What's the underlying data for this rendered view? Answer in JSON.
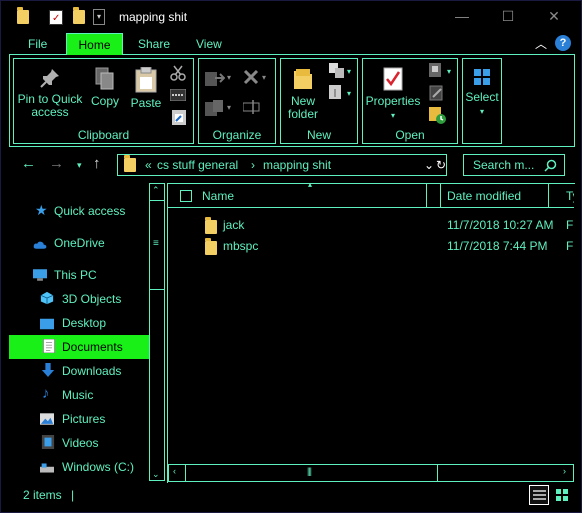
{
  "window": {
    "title": "mapping shit",
    "minimize_glyph": "—",
    "maximize_glyph": "☐",
    "close_glyph": "✕"
  },
  "ribbon_tabs": [
    {
      "label": "File"
    },
    {
      "label": "Home"
    },
    {
      "label": "Share"
    },
    {
      "label": "View"
    }
  ],
  "ribbon": {
    "clipboard": {
      "label": "Clipboard",
      "pin_label_1": "Pin to Quick",
      "pin_label_2": "access",
      "copy_label": "Copy",
      "paste_label": "Paste"
    },
    "organize": {
      "label": "Organize"
    },
    "new": {
      "label": "New",
      "new_folder_1": "New",
      "new_folder_2": "folder"
    },
    "open": {
      "label": "Open",
      "properties": "Properties"
    },
    "select": {
      "label": "Select"
    }
  },
  "address": {
    "overflow": "«",
    "crumbs": [
      "cs stuff general",
      "mapping shit"
    ],
    "search_placeholder": "Search m..."
  },
  "nav_items": [
    {
      "label": "Quick access"
    },
    {
      "label": "OneDrive"
    },
    {
      "label": "This PC"
    },
    {
      "label": "3D Objects"
    },
    {
      "label": "Desktop"
    },
    {
      "label": "Documents"
    },
    {
      "label": "Downloads"
    },
    {
      "label": "Music"
    },
    {
      "label": "Pictures"
    },
    {
      "label": "Videos"
    },
    {
      "label": "Windows (C:)"
    }
  ],
  "columns": {
    "name": "Name",
    "date": "Date modified",
    "type": "Ty"
  },
  "files": [
    {
      "name": "jack",
      "date": "11/7/2018 10:27 AM",
      "type": "Fi"
    },
    {
      "name": "mbspc",
      "date": "11/7/2018 7:44 PM",
      "type": "Fi"
    }
  ],
  "status": {
    "items": "2 items"
  },
  "colors": {
    "accent": "#5ff0c0",
    "highlight": "#18f018",
    "background": "#000000",
    "folder": "#f3cf63"
  }
}
